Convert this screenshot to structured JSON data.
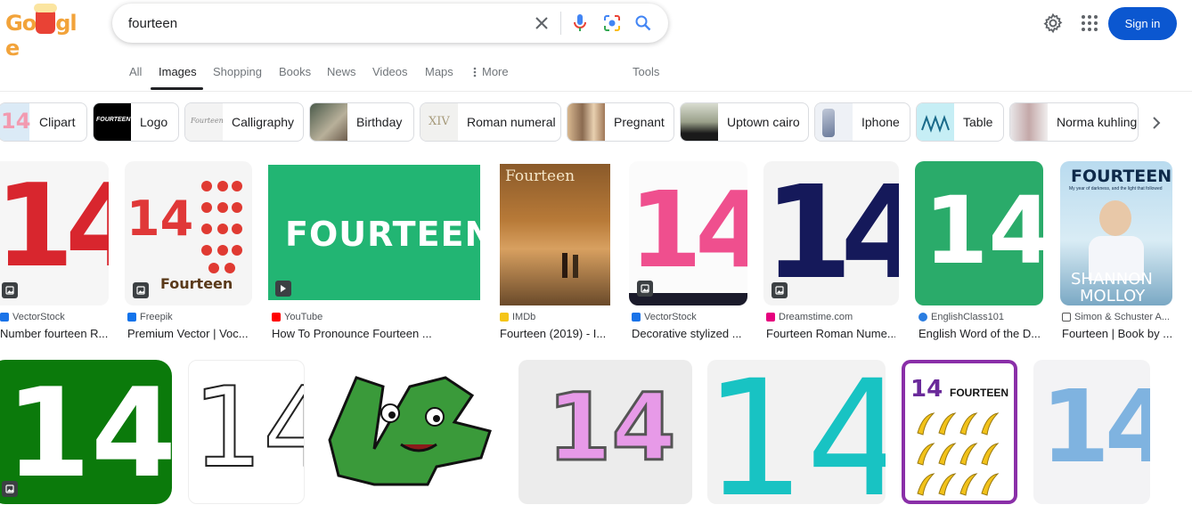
{
  "header": {
    "logo_text": [
      "G",
      "o",
      "o",
      "g",
      "l",
      "e"
    ],
    "search_value": "fourteen",
    "sign_in": "Sign in"
  },
  "tabs": [
    {
      "label": "All"
    },
    {
      "label": "Images"
    },
    {
      "label": "Shopping"
    },
    {
      "label": "Books"
    },
    {
      "label": "News"
    },
    {
      "label": "Videos"
    },
    {
      "label": "Maps"
    },
    {
      "label": "More"
    },
    {
      "label": "Tools"
    }
  ],
  "chips": [
    {
      "label": "Clipart"
    },
    {
      "label": "Logo"
    },
    {
      "label": "Calligraphy"
    },
    {
      "label": "Birthday"
    },
    {
      "label": "Roman numeral"
    },
    {
      "label": "Pregnant"
    },
    {
      "label": "Uptown cairo"
    },
    {
      "label": "Iphone"
    },
    {
      "label": "Table"
    },
    {
      "label": "Norma kuhling"
    }
  ],
  "results_row1": [
    {
      "source": "VectorStock",
      "title": "Number fourteen R..."
    },
    {
      "source": "Freepik",
      "title": "Premium Vector | Voc..."
    },
    {
      "source": "YouTube",
      "title": "How To Pronounce Fourteen ..."
    },
    {
      "source": "IMDb",
      "title": "Fourteen (2019) - I..."
    },
    {
      "source": "VectorStock",
      "title": "Decorative stylized ..."
    },
    {
      "source": "Dreamstime.com",
      "title": "Fourteen Roman Nume..."
    },
    {
      "source": "EnglishClass101",
      "title": "English Word of the D..."
    },
    {
      "source": "Simon & Schuster A...",
      "title": "Fourteen | Book by ..."
    }
  ],
  "image_text": {
    "fourteen_label": "Fourteen",
    "fourteen_banner": "FOURTEEN",
    "movie_title": "Fourteen",
    "book_title": "FOURTEEN",
    "book_subtitle": "My year of darkness, and the light that followed",
    "book_author_1": "SHANNON",
    "book_author_2": "MOLLOY",
    "banana_title": "FOURTEEN",
    "num": "14"
  },
  "colors": {
    "accent": "#0b57d0",
    "youtube_green": "#22b573",
    "green_tile": "#2aab6a",
    "dark_green": "#0b7a0b",
    "teal": "#18c3c3"
  }
}
